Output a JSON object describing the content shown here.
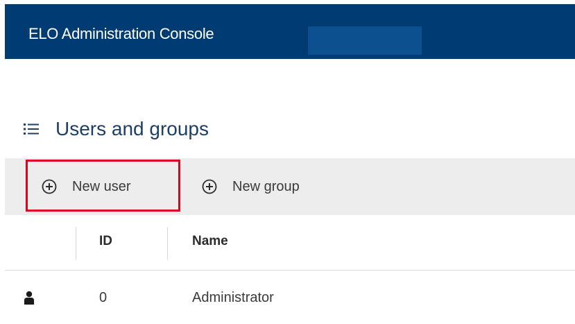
{
  "header": {
    "title": "ELO Administration Console",
    "background_color": "#003b72"
  },
  "section": {
    "title": "Users and groups",
    "icon": "list-icon"
  },
  "toolbar": {
    "new_user_label": "New user",
    "new_group_label": "New group",
    "button_icon": "plus-circle-icon",
    "highlight_color": "#e3001b"
  },
  "table": {
    "columns": [
      "",
      "ID",
      "Name"
    ],
    "rows": [
      {
        "type_icon": "user-icon",
        "id": "0",
        "name": "Administrator"
      }
    ]
  }
}
